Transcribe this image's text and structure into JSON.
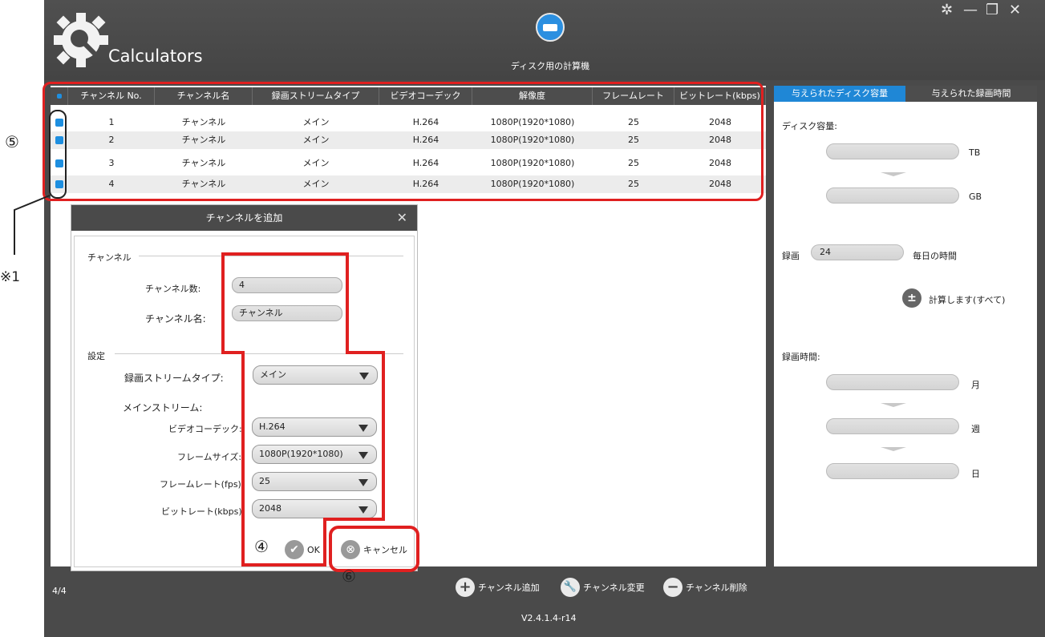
{
  "app": {
    "title": "Calculators",
    "disk_label": "ディスク用の計算機",
    "version": "V2.4.1.4-r14",
    "count": "4/4"
  },
  "table": {
    "headers": [
      "チャンネル No.",
      "チャンネル名",
      "録画ストリームタイプ",
      "ビデオコーデック",
      "解像度",
      "フレームレート",
      "ビットレート(kbps)"
    ],
    "rows": [
      [
        "1",
        "チャンネル",
        "メイン",
        "H.264",
        "1080P(1920*1080)",
        "25",
        "2048"
      ],
      [
        "2",
        "チャンネル",
        "メイン",
        "H.264",
        "1080P(1920*1080)",
        "25",
        "2048"
      ],
      [
        "3",
        "チャンネル",
        "メイン",
        "H.264",
        "1080P(1920*1080)",
        "25",
        "2048"
      ],
      [
        "4",
        "チャンネル",
        "メイン",
        "H.264",
        "1080P(1920*1080)",
        "25",
        "2048"
      ]
    ]
  },
  "right": {
    "tab1": "与えられたディスク容量",
    "tab2": "与えられた録画時間",
    "disk_capacity": "ディスク容量:",
    "tb": "TB",
    "gb": "GB",
    "record": "録画",
    "record_value": "24",
    "per_day": "毎日の時間",
    "calc": "計算します(すべて)",
    "record_time": "録画時間:",
    "month": "月",
    "week": "週",
    "day": "日"
  },
  "bottom": {
    "add": "チャンネル追加",
    "change": "チャンネル変更",
    "delete": "チャンネル削除"
  },
  "dialog": {
    "title": "チャンネルを追加",
    "channel_section": "チャンネル",
    "channel_count_label": "チャンネル数:",
    "channel_count": "4",
    "channel_name_label": "チャンネル名:",
    "channel_name": "チャンネル",
    "settings_section": "設定",
    "stream_type_label": "録画ストリームタイプ:",
    "stream_type": "メイン",
    "main_stream_label": "メインストリーム:",
    "codec_label": "ビデオコーデック:",
    "codec": "H.264",
    "frame_size_label": "フレームサイズ:",
    "frame_size": "1080P(1920*1080)",
    "frame_rate_label": "フレームレート(fps):",
    "frame_rate": "25",
    "bitrate_label": "ビットレート(kbps):",
    "bitrate": "2048",
    "ok": "OK",
    "cancel": "キャンセル"
  },
  "annotations": {
    "five": "⑤",
    "four": "④",
    "six": "⑥",
    "note": "※1"
  },
  "colors": {
    "accent": "#1f87d6",
    "highlight": "#e02020",
    "bg_dark": "#4a4a4a"
  }
}
